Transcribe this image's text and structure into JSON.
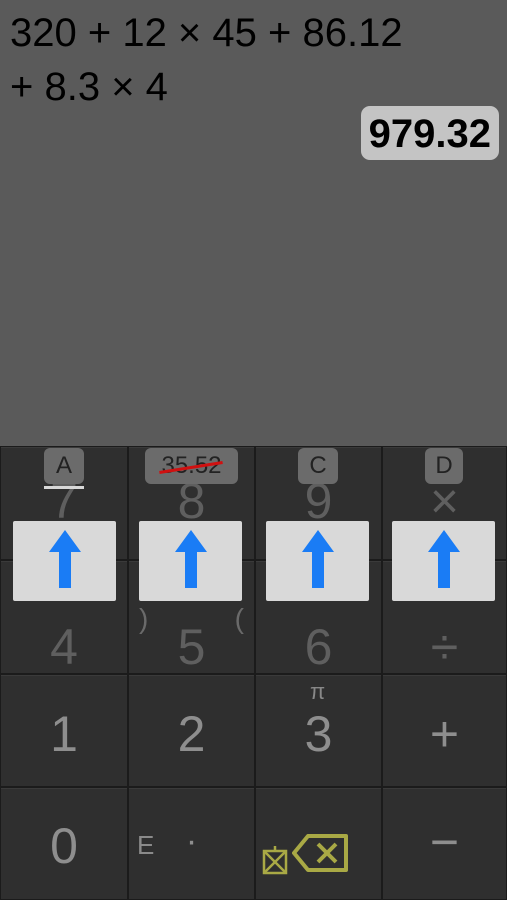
{
  "display": {
    "expression_line1": "320 + 12 × 45 + 86.12",
    "expression_line2": "+ 8.3 × 4",
    "result": "979.32"
  },
  "memory": {
    "a": "A",
    "b": "35.52",
    "c": "C",
    "d": "D"
  },
  "keys": {
    "k7": "7",
    "k8": "8",
    "k9": "9",
    "multiply": "×",
    "k4": "4",
    "k5": "5",
    "k6": "6",
    "divide": "÷",
    "close_paren": ")",
    "open_paren": "(",
    "k1": "1",
    "k2": "2",
    "k3": "3",
    "plus": "+",
    "pi": "π",
    "k0": "0",
    "exponent": "E",
    "decimal": "·",
    "minus": "−"
  },
  "colors": {
    "display_bg": "#5a5a5a",
    "result_bg": "#c4c4c4",
    "arrow": "#1a7cf5",
    "backspace": "#a9a945",
    "strike": "#d01010"
  },
  "icons": {
    "store_arrow": "arrow-up-icon",
    "backspace": "backspace-icon",
    "clear": "clear-icon"
  }
}
